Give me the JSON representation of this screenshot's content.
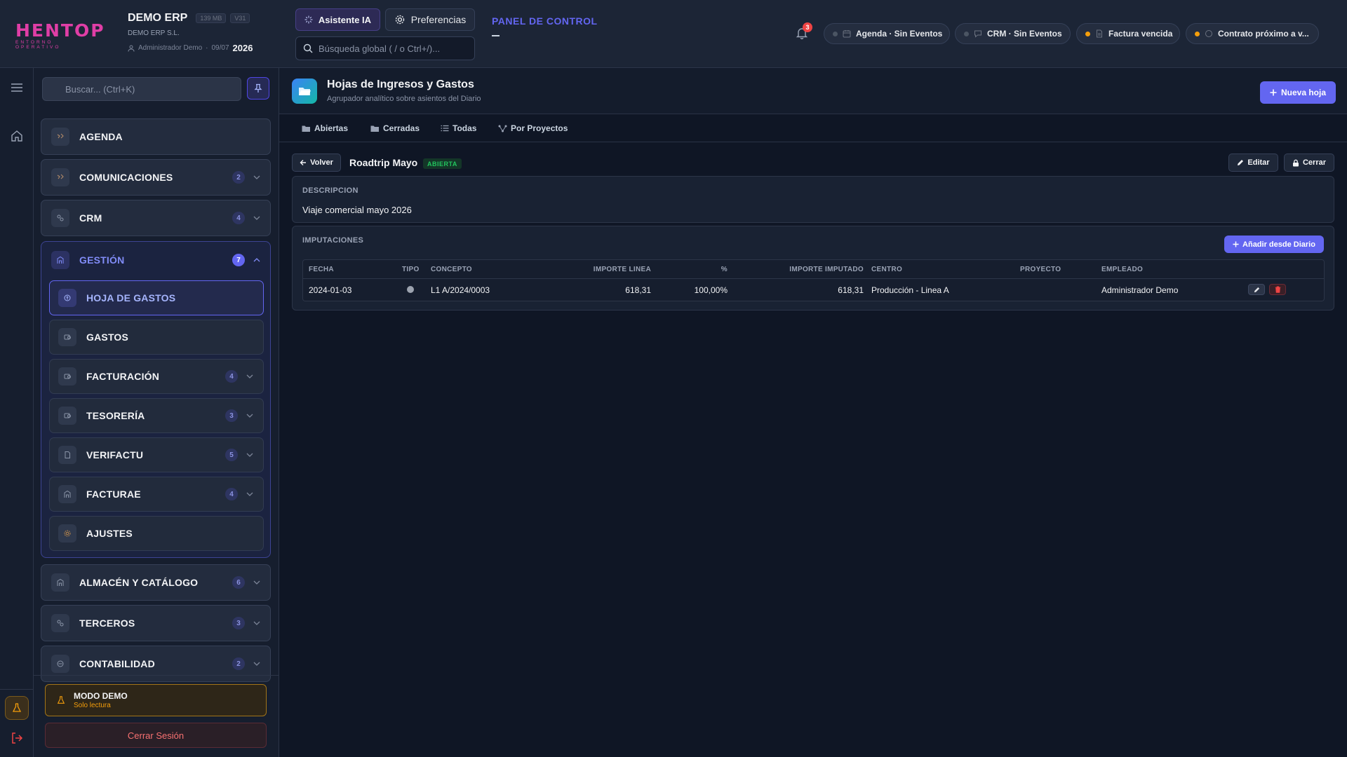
{
  "header": {
    "logo_text": "HENTOP",
    "logo_subtitle": "ENTORNO OPERATIVO",
    "company_name": "DEMO ERP",
    "memory_chip": "139 MB",
    "version_chip": "V31",
    "company_legal": "DEMO ERP S.L.",
    "user_name": "Administrador Demo",
    "date_short": "09/07",
    "year": "2026",
    "assistant_label": "Asistente IA",
    "preferences_label": "Preferencias",
    "search_placeholder": "Búsqueda global ( / o Ctrl+/)...",
    "panel_title": "PANEL DE CONTROL",
    "notifications_count": "3",
    "pills": [
      {
        "label": "Agenda · Sin Eventos",
        "dot_color": "#4b5563"
      },
      {
        "label": "CRM · Sin Eventos",
        "dot_color": "#4b5563"
      },
      {
        "label": "Factura vencida",
        "dot_color": "#f59e0b"
      },
      {
        "label": "Contrato próximo a v...",
        "dot_color": "#f59e0b"
      }
    ]
  },
  "sidebar": {
    "search_placeholder": "Buscar... (Ctrl+K)",
    "items": [
      {
        "label": "AGENDA",
        "badge": ""
      },
      {
        "label": "COMUNICACIONES",
        "badge": "2"
      },
      {
        "label": "CRM",
        "badge": "4"
      }
    ],
    "group": {
      "label": "GESTIÓN",
      "badge": "7",
      "children": [
        {
          "label": "HOJA DE GASTOS",
          "badge": ""
        },
        {
          "label": "GASTOS",
          "badge": ""
        },
        {
          "label": "FACTURACIÓN",
          "badge": "4"
        },
        {
          "label": "TESORERÍA",
          "badge": "3"
        },
        {
          "label": "VERIFACTU",
          "badge": "5"
        },
        {
          "label": "FACTURAE",
          "badge": "4"
        },
        {
          "label": "AJUSTES",
          "badge": ""
        }
      ]
    },
    "items_after": [
      {
        "label": "ALMACÉN Y CATÁLOGO",
        "badge": "6"
      },
      {
        "label": "TERCEROS",
        "badge": "3"
      },
      {
        "label": "CONTABILIDAD",
        "badge": "2"
      }
    ],
    "demo_title": "MODO DEMO",
    "demo_subtitle": "Solo lectura",
    "logout_label": "Cerrar Sesión"
  },
  "page": {
    "title": "Hojas de Ingresos y Gastos",
    "subtitle": "Agrupador analítico sobre asientos del Diario",
    "new_button": "Nueva hoja",
    "tabs": [
      {
        "label": "Abiertas"
      },
      {
        "label": "Cerradas"
      },
      {
        "label": "Todas"
      },
      {
        "label": "Por Proyectos"
      }
    ],
    "back_label": "Volver",
    "sheet_title": "Roadtrip Mayo",
    "sheet_status": "ABIERTA",
    "edit_label": "Editar",
    "close_label": "Cerrar",
    "description_label": "DESCRIPCION",
    "description_text": "Viaje comercial mayo 2026",
    "imputaciones_label": "IMPUTACIONES",
    "add_from_journal": "Añadir desde Diario",
    "columns": [
      "FECHA",
      "TIPO",
      "CONCEPTO",
      "IMPORTE LINEA",
      "%",
      "IMPORTE IMPUTADO",
      "CENTRO",
      "PROYECTO",
      "EMPLEADO"
    ],
    "rows": [
      {
        "fecha": "2024-01-03",
        "concepto": "L1 A/2024/0003",
        "importe_linea": "618,31",
        "porcentaje": "100,00%",
        "importe_imputado": "618,31",
        "centro": "Producción - Linea A",
        "proyecto": "",
        "empleado": "Administrador Demo"
      }
    ]
  },
  "colors": {
    "accent": "#6366f1",
    "brand": "#e03ea6",
    "success": "#22c55e",
    "warning": "#f59e0b",
    "danger": "#ef4444"
  }
}
